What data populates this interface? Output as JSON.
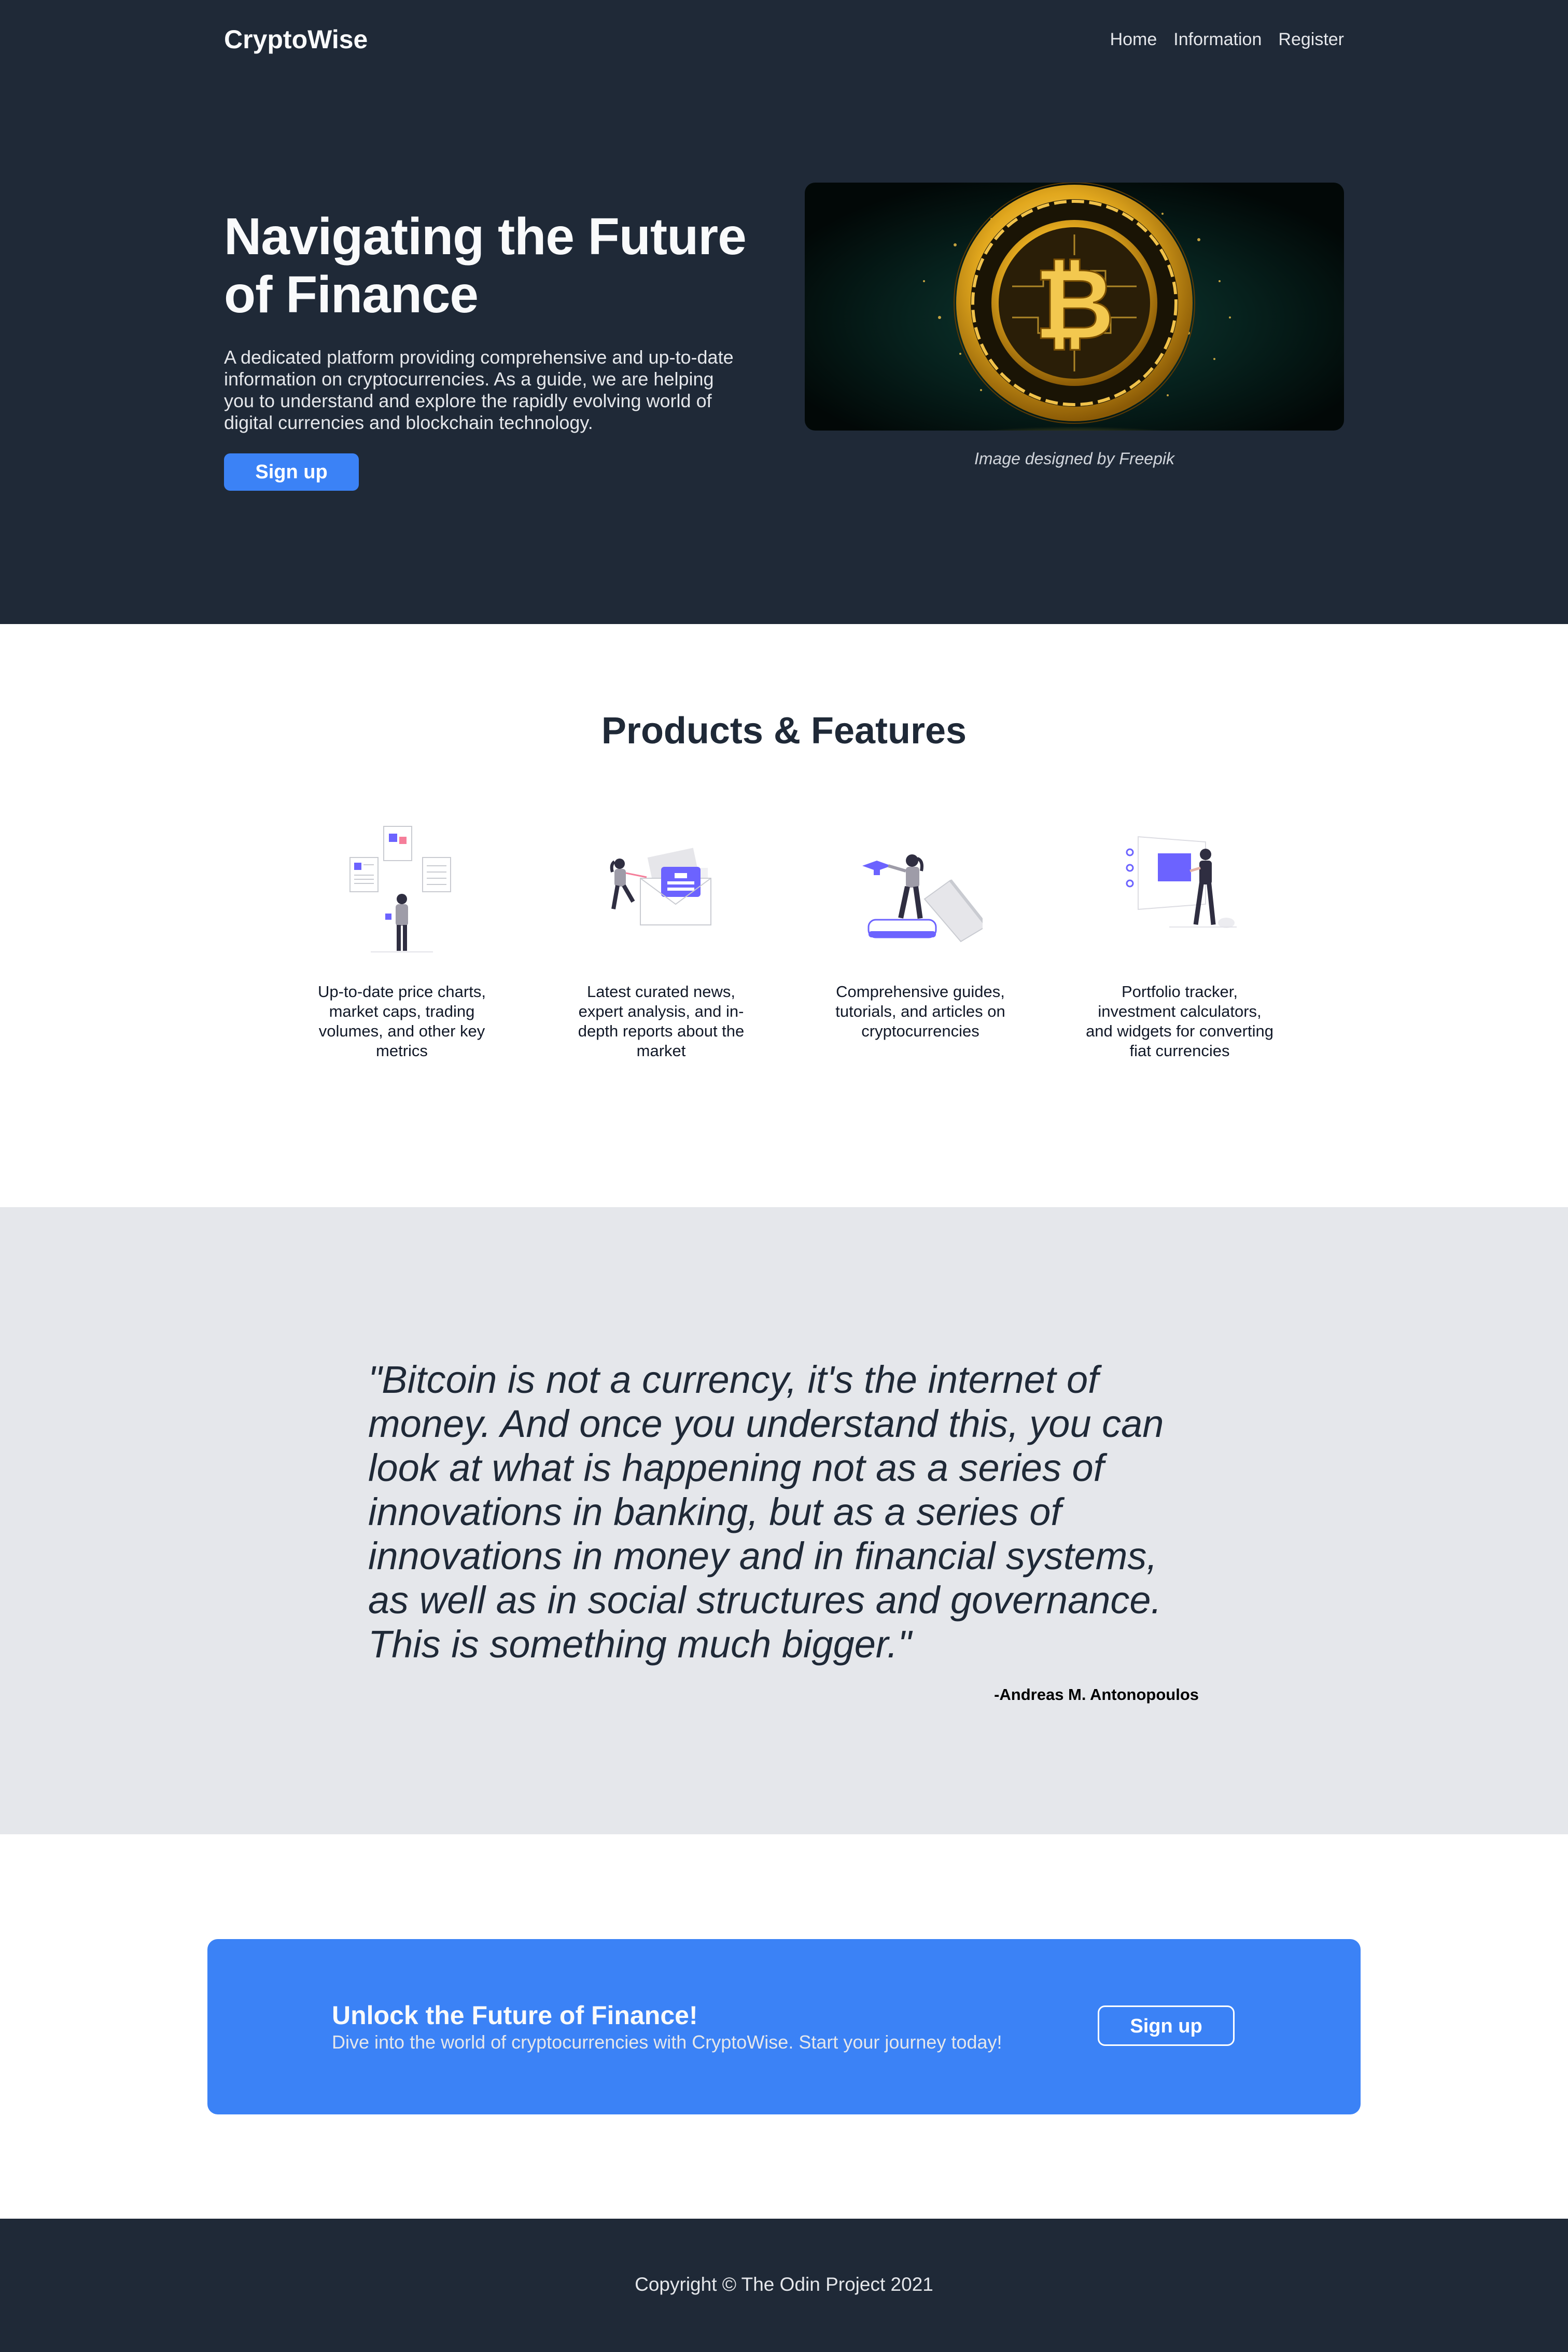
{
  "nav": {
    "logo": "CryptoWise",
    "links": [
      "Home",
      "Information",
      "Register"
    ]
  },
  "hero": {
    "title": "Navigating the Future of Finance",
    "description": "A dedicated platform providing comprehensive and up-to-date information on cryptocurrencies. As a guide, we are helping you to understand and explore the rapidly evolving world of digital currencies and blockchain technology.",
    "signup_label": "Sign up",
    "image_caption": "Image designed by Freepik"
  },
  "features": {
    "title": "Products & Features",
    "items": [
      {
        "icon": "price-charts-illustration-icon",
        "text": "Up-to-date price charts, market caps, trading volumes, and other key metrics"
      },
      {
        "icon": "news-envelope-illustration-icon",
        "text": "Latest curated news, expert analysis, and in-depth reports about the market"
      },
      {
        "icon": "learning-books-illustration-icon",
        "text": "Comprehensive guides, tutorials, and articles on cryptocurrencies"
      },
      {
        "icon": "portfolio-board-illustration-icon",
        "text": "Portfolio tracker, investment calculators, and widgets for converting fiat currencies"
      }
    ]
  },
  "quote": {
    "text": "\"Bitcoin is not a currency, it's the internet of money. And once you understand this, you can look at what is happening not as a series of innovations in banking, but as a series of innovations in money and in financial systems, as well as in social structures and governance. This is something much bigger.\"",
    "author": "-Andreas M. Antonopoulos"
  },
  "cta": {
    "title": "Unlock the Future of Finance!",
    "subtitle": "Dive into the world of cryptocurrencies with CryptoWise. Start your journey today!",
    "signup_label": "Sign up"
  },
  "footer": {
    "copyright": "Copyright © The Odin Project 2021"
  },
  "colors": {
    "dark": "#1f2937",
    "accent": "#3b82f6",
    "quote_bg": "#e5e7eb",
    "illustration": "#6c63ff"
  }
}
